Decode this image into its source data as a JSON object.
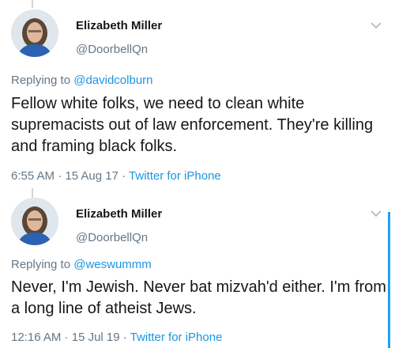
{
  "tweets": [
    {
      "name": "Elizabeth Miller",
      "handle": "@DoorbellQn",
      "replying_prefix": "Replying to ",
      "replying_to": "@davidcolburn",
      "text": "Fellow white folks, we need to clean white supremacists out of law enforcement. They're killing and framing black folks.",
      "time": "6:55 AM",
      "date": "15 Aug 17",
      "source": "Twitter for iPhone",
      "separator": " · "
    },
    {
      "name": "Elizabeth Miller",
      "handle": "@DoorbellQn",
      "replying_prefix": "Replying to ",
      "replying_to": "@weswummm",
      "text": "Never, I'm Jewish. Never bat mizvah'd either. I'm from a long line of atheist Jews.",
      "time": "12:16 AM",
      "date": "15 Jul 19",
      "source": "Twitter for iPhone",
      "separator": " · "
    }
  ],
  "icons": {
    "more": "chevron-down-icon",
    "avatar": "avatar"
  },
  "colors": {
    "link": "#1b95e0",
    "secondary_text": "#657786",
    "primary_text": "#14171a",
    "thread_line": "#ccd6dd",
    "accent": "#1da1f2"
  }
}
